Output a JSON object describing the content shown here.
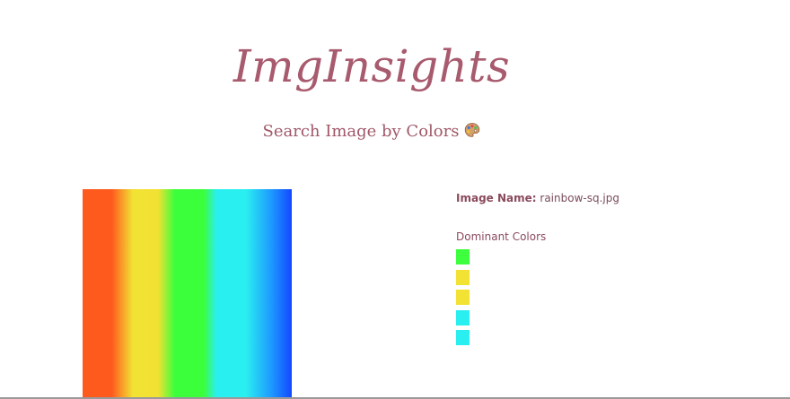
{
  "header": {
    "app_title": "ImgInsights",
    "subtitle": "Search Image by Colors",
    "subtitle_icon": "artist-palette-icon"
  },
  "image": {
    "alt": "rainbow-sq.jpg preview",
    "colors": [
      "#ff5a1e",
      "#f1e233",
      "#3cff3c",
      "#2aeff0",
      "#1448ff"
    ]
  },
  "info": {
    "name_label": "Image Name:",
    "name_value": "rainbow-sq.jpg",
    "dominant_heading": "Dominant Colors",
    "dominant_colors": [
      "#3dff3d",
      "#f1e233",
      "#f1e233",
      "#2aeff0",
      "#2aeff0"
    ]
  },
  "colors": {
    "title": "#a85a6e",
    "text": "#8a4a5c"
  }
}
